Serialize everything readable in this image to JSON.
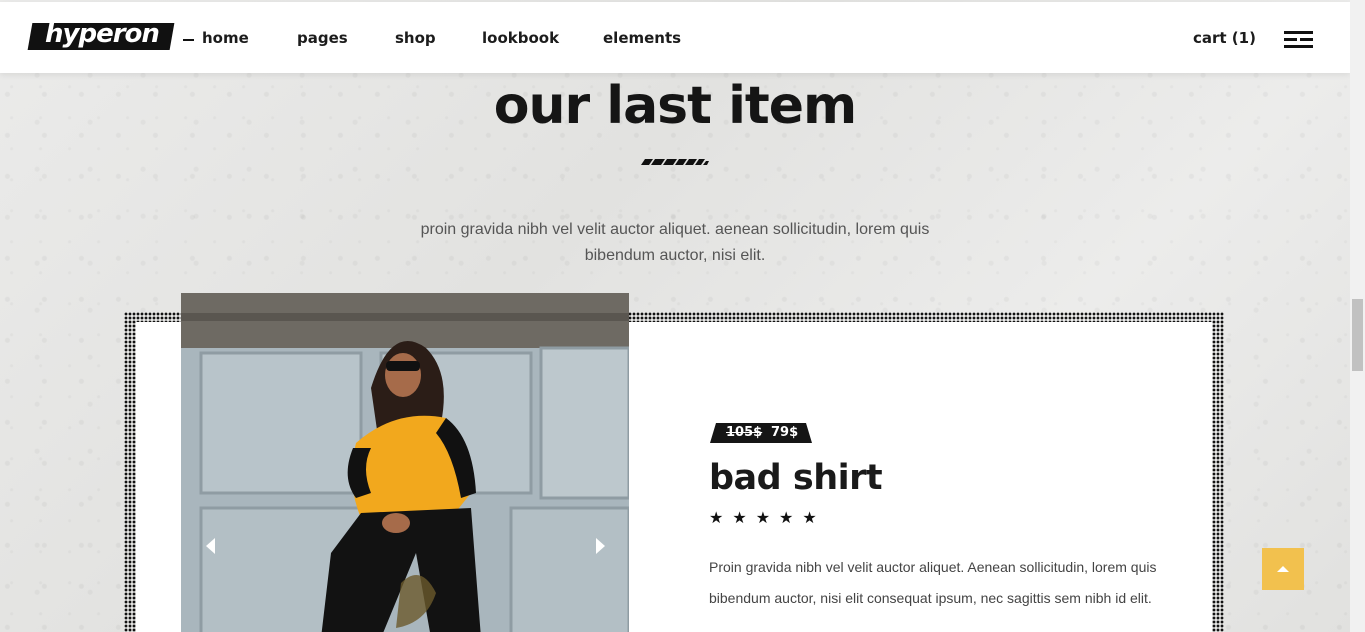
{
  "header": {
    "logo_text": "hyperon",
    "nav": [
      "home",
      "pages",
      "shop",
      "lookbook",
      "elements"
    ],
    "cart_label": "cart (1)"
  },
  "section": {
    "title": "our last item",
    "text": "proin gravida nibh vel velit auctor aliquet. aenean sollicitudin, lorem quis bibendum auctor, nisi elit."
  },
  "product": {
    "price_old": "105$",
    "price_new": "79$",
    "name": "bad shirt",
    "stars": "★★★★★",
    "rating": 5,
    "description": "Proin gravida nibh vel velit auctor aliquet. Aenean sollicitudin, lorem quis bibendum auctor, nisi elit consequat ipsum, nec sagittis sem nibh id elit."
  },
  "colors": {
    "accent": "#f2c14e",
    "dark": "#111111",
    "background": "#e6e6e4"
  }
}
